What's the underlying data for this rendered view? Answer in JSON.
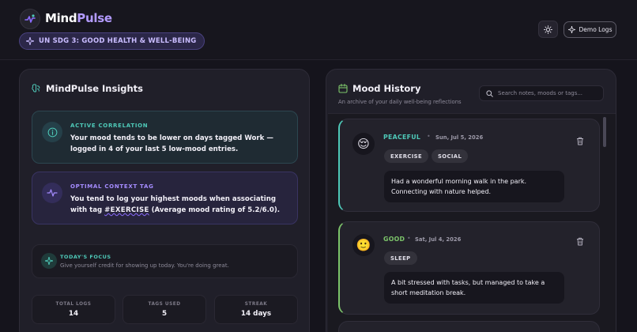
{
  "header": {
    "brand_first": "Mind",
    "brand_second": "Pulse",
    "sdg_label": "UN SDG 3: GOOD HEALTH & WELL-BEING",
    "demo_button": "Demo Logs",
    "theme_icon": "sun-icon",
    "sdg_icon": "sparkle-icon"
  },
  "insights": {
    "title": "MindPulse Insights",
    "correlation": {
      "label": "ACTIVE CORRELATION",
      "text": "Your mood tends to be lower on days tagged Work — logged in 4 of your last 5 low-mood entries."
    },
    "context": {
      "label": "OPTIMAL CONTEXT TAG",
      "text_before": "You tend to log your highest moods when associating with tag",
      "tag": "#EXERCISE",
      "text_after": "(Average mood rating of 5.2/6.0)."
    },
    "focus": {
      "label": "TODAY'S FOCUS",
      "text": "Give yourself credit for showing up today. You're doing great."
    },
    "stats": [
      {
        "label": "TOTAL LOGS",
        "value": "14"
      },
      {
        "label": "TAGS USED",
        "value": "5"
      },
      {
        "label": "STREAK",
        "value": "14 days"
      }
    ]
  },
  "history": {
    "title": "Mood History",
    "subtitle": "An archive of your daily well-being reflections",
    "search_placeholder": "Search notes, moods or tags...",
    "entries": [
      {
        "mood": "PEACEFUL",
        "date": "Sun, Jul 5, 2026",
        "tags": [
          "EXERCISE",
          "SOCIAL"
        ],
        "note": "Had a wonderful morning walk in the park. Connecting with nature helped.",
        "accent": "#4ec9b8",
        "emoji": "😌"
      },
      {
        "mood": "GOOD",
        "date": "Sat, Jul 4, 2026",
        "tags": [
          "SLEEP"
        ],
        "note": "A bit stressed with tasks, but managed to take a short meditation break.",
        "accent": "#7cc46a",
        "emoji": "🙂"
      }
    ]
  },
  "colors": {
    "accent_purple": "#b39bff",
    "accent_teal": "#4ec9b8",
    "accent_green": "#7cc46a"
  }
}
